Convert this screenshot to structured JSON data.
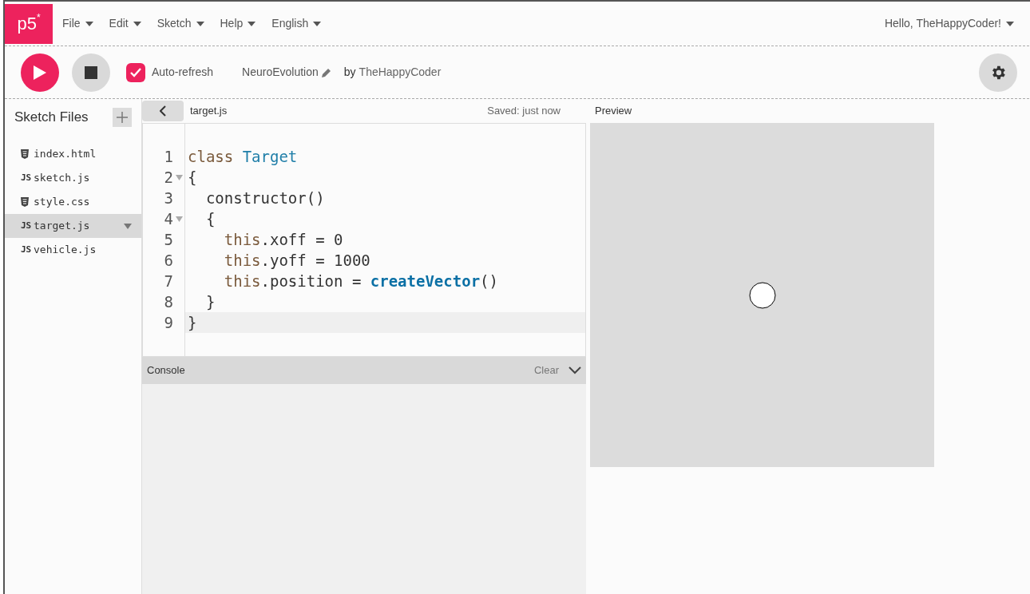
{
  "logo": {
    "text": "p5",
    "mark": "*"
  },
  "menu": [
    {
      "label": "File"
    },
    {
      "label": "Edit"
    },
    {
      "label": "Sketch"
    },
    {
      "label": "Help"
    },
    {
      "label": "English"
    }
  ],
  "user_menu": {
    "label": "Hello, TheHappyCoder!"
  },
  "toolbar": {
    "auto_refresh": {
      "label": "Auto-refresh",
      "checked": true
    },
    "sketch_name": "NeuroEvolution",
    "author_prefix": "by",
    "author": "TheHappyCoder"
  },
  "sidebar": {
    "title": "Sketch Files",
    "files": [
      {
        "name": "index.html",
        "kind": "markup",
        "selected": false
      },
      {
        "name": "sketch.js",
        "kind": "script",
        "badge": "JS",
        "selected": false
      },
      {
        "name": "style.css",
        "kind": "markup",
        "selected": false
      },
      {
        "name": "target.js",
        "kind": "script",
        "badge": "JS",
        "selected": true
      },
      {
        "name": "vehicle.js",
        "kind": "script",
        "badge": "JS",
        "selected": false
      }
    ]
  },
  "editor": {
    "file_name": "target.js",
    "status": "Saved: just now",
    "lines": [
      {
        "number": "1",
        "fold": false,
        "active": false,
        "tokens": [
          {
            "text": "class ",
            "kind": "keyword"
          },
          {
            "text": "Target",
            "kind": "def"
          }
        ]
      },
      {
        "number": "2",
        "fold": true,
        "active": false,
        "tokens": [
          {
            "text": "{",
            "kind": "plain"
          }
        ]
      },
      {
        "number": "3",
        "fold": false,
        "active": false,
        "tokens": [
          {
            "text": "  constructor()",
            "kind": "plain"
          }
        ]
      },
      {
        "number": "4",
        "fold": true,
        "active": false,
        "tokens": [
          {
            "text": "  {",
            "kind": "plain"
          }
        ]
      },
      {
        "number": "5",
        "fold": false,
        "active": false,
        "tokens": [
          {
            "text": "    this",
            "kind": "keyword"
          },
          {
            "text": ".xoff = 0",
            "kind": "plain"
          }
        ]
      },
      {
        "number": "6",
        "fold": false,
        "active": false,
        "tokens": [
          {
            "text": "    this",
            "kind": "keyword"
          },
          {
            "text": ".yoff = 1000",
            "kind": "plain"
          }
        ]
      },
      {
        "number": "7",
        "fold": false,
        "active": false,
        "tokens": [
          {
            "text": "    this",
            "kind": "keyword"
          },
          {
            "text": ".position = ",
            "kind": "plain"
          },
          {
            "text": "createVector",
            "kind": "builtin"
          },
          {
            "text": "()",
            "kind": "plain"
          }
        ]
      },
      {
        "number": "8",
        "fold": false,
        "active": false,
        "tokens": [
          {
            "text": "  }",
            "kind": "plain"
          }
        ]
      },
      {
        "number": "9",
        "fold": false,
        "active": true,
        "tokens": [
          {
            "text": "}",
            "kind": "plain"
          }
        ]
      }
    ]
  },
  "console": {
    "title": "Console",
    "clear": "Clear"
  },
  "preview": {
    "title": "Preview"
  }
}
